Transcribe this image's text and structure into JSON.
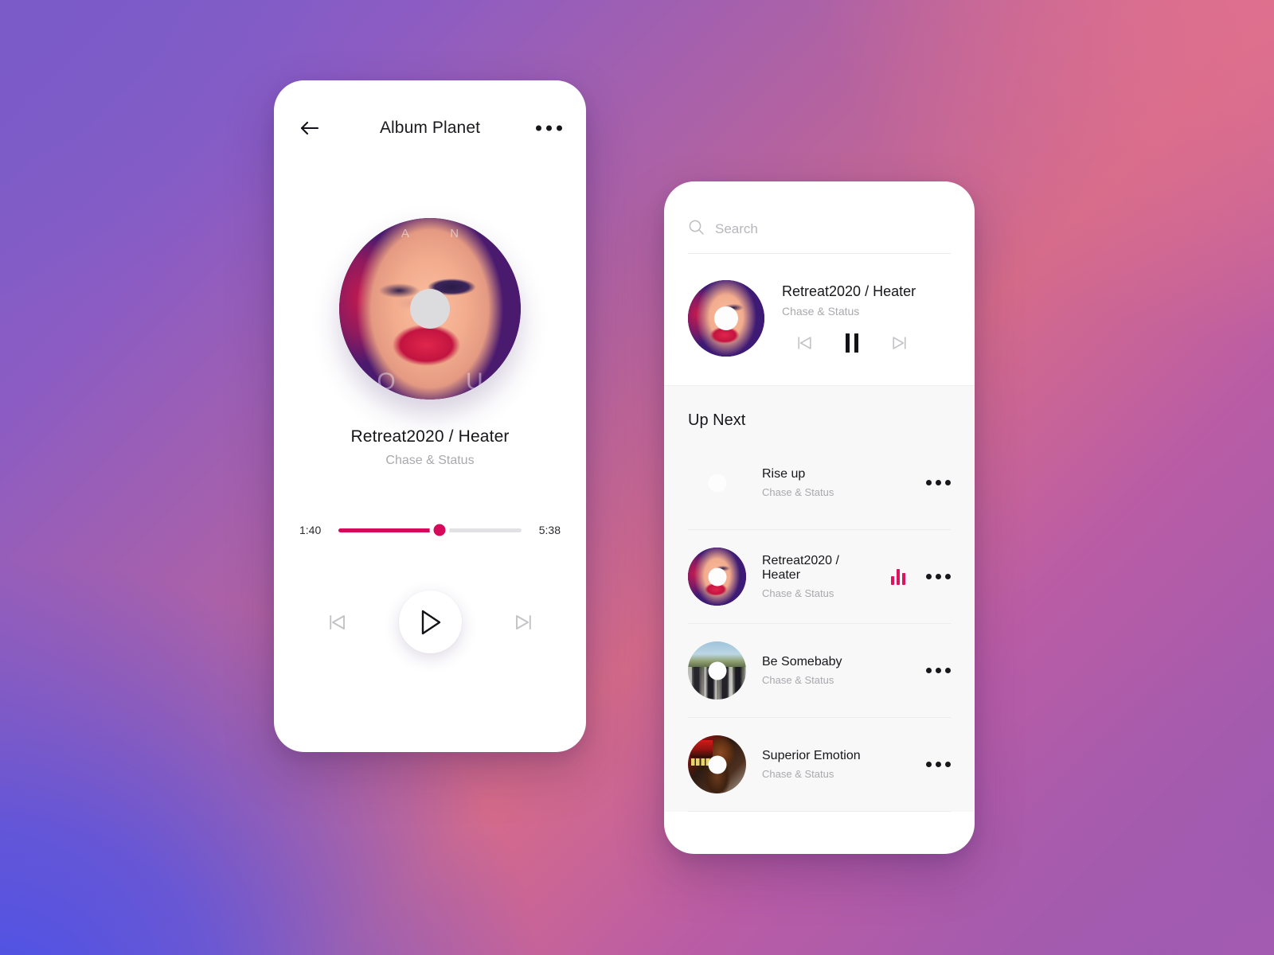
{
  "theme": {
    "accent": "#d6095a",
    "eq_color": "#e0125f",
    "bg_top_left": "#7a5bc8",
    "bg_top_right": "#d56b8a",
    "bg_bottom_left": "#4b52e8",
    "bg_bottom_right": "#a55bad",
    "card_bg": "#ffffff",
    "up_next_bg": "#f8f8f9"
  },
  "player": {
    "header": {
      "back_icon": "arrow-left-icon",
      "title": "Album Planet",
      "more_icon": "more-horizontal-icon"
    },
    "artwork": {
      "icon": "album-disc-icon",
      "top_letters": "A N",
      "bottom_letters": "O U"
    },
    "track": {
      "title": "Retreat2020 / Heater",
      "artist": "Chase & Status"
    },
    "progress": {
      "current_time": "1:40",
      "total_time": "5:38",
      "percent": 55
    },
    "controls": {
      "previous_label": "skip-back-icon",
      "play_label": "play-icon",
      "next_label": "skip-forward-icon"
    }
  },
  "queue": {
    "search": {
      "icon": "search-icon",
      "placeholder": "Search",
      "value": ""
    },
    "now_playing": {
      "artwork_icon": "album-disc-icon",
      "title": "Retreat2020 / Heater",
      "artist": "Chase & Status",
      "previous_label": "skip-back-icon",
      "pause_label": "pause-icon",
      "next_label": "skip-forward-icon"
    },
    "up_next": {
      "title": "Up Next",
      "items": [
        {
          "title": "Rise up",
          "artist": "Chase & Status",
          "artwork_icon": "album-disc-icon",
          "playing": false,
          "more_icon": "more-horizontal-icon"
        },
        {
          "title": "Retreat2020 / Heater",
          "artist": "Chase & Status",
          "artwork_icon": "album-disc-icon",
          "playing": true,
          "more_icon": "more-horizontal-icon"
        },
        {
          "title": "Be Somebaby",
          "artist": "Chase & Status",
          "artwork_icon": "album-disc-icon",
          "playing": false,
          "more_icon": "more-horizontal-icon"
        },
        {
          "title": "Superior Emotion",
          "artist": "Chase & Status",
          "artwork_icon": "album-disc-icon",
          "playing": false,
          "more_icon": "more-horizontal-icon"
        }
      ]
    }
  }
}
